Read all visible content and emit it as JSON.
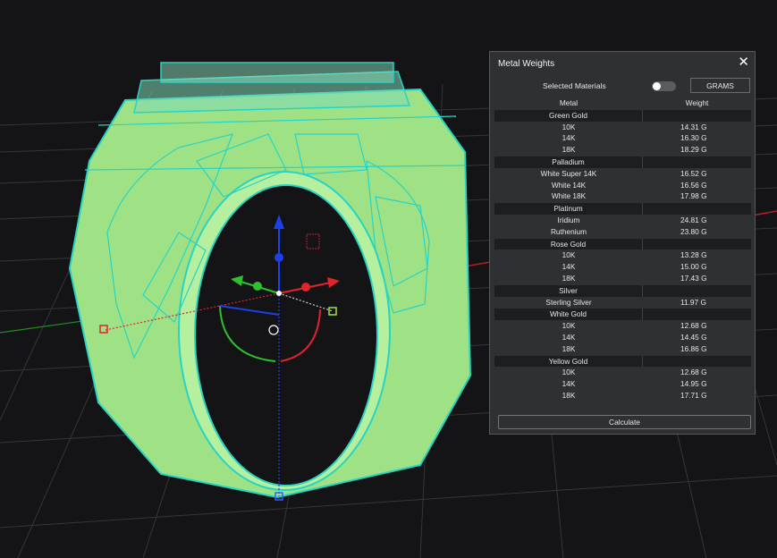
{
  "panel": {
    "title": "Metal Weights",
    "close_icon": "close-icon",
    "selected_materials_label": "Selected Materials",
    "selected_materials_on": false,
    "units_label": "GRAMS",
    "columns": {
      "metal": "Metal",
      "weight": "Weight"
    },
    "groups": [
      {
        "name": "Green Gold",
        "rows": [
          {
            "metal": "10K",
            "weight": "14.31 G"
          },
          {
            "metal": "14K",
            "weight": "16.30 G"
          },
          {
            "metal": "18K",
            "weight": "18.29 G"
          }
        ]
      },
      {
        "name": "Palladium",
        "rows": [
          {
            "metal": "White Super 14K",
            "weight": "16.52 G"
          },
          {
            "metal": "White 14K",
            "weight": "16.56 G"
          },
          {
            "metal": "White 18K",
            "weight": "17.98 G"
          }
        ]
      },
      {
        "name": "Platinum",
        "rows": [
          {
            "metal": "Iridium",
            "weight": "24.81 G"
          },
          {
            "metal": "Ruthenium",
            "weight": "23.80 G"
          }
        ]
      },
      {
        "name": "Rose Gold",
        "rows": [
          {
            "metal": "10K",
            "weight": "13.28 G"
          },
          {
            "metal": "14K",
            "weight": "15.00 G"
          },
          {
            "metal": "18K",
            "weight": "17.43 G"
          }
        ]
      },
      {
        "name": "Silver",
        "rows": [
          {
            "metal": "Sterling Silver",
            "weight": "11.97 G"
          }
        ]
      },
      {
        "name": "White Gold",
        "rows": [
          {
            "metal": "10K",
            "weight": "12.68 G"
          },
          {
            "metal": "14K",
            "weight": "14.45 G"
          },
          {
            "metal": "18K",
            "weight": "16.86 G"
          }
        ]
      },
      {
        "name": "Yellow Gold",
        "rows": [
          {
            "metal": "10K",
            "weight": "12.68 G"
          },
          {
            "metal": "14K",
            "weight": "14.95 G"
          },
          {
            "metal": "18K",
            "weight": "17.71 G"
          }
        ]
      }
    ],
    "calculate_label": "Calculate"
  },
  "viewport": {
    "background": "#141416",
    "grid_color": "#3a3a3d",
    "axis_x_color": "#e0242a",
    "axis_y_color": "#2fbf2f",
    "axis_z_color": "#1f3fe8",
    "ring_fill": "#a8e890",
    "ring_wire": "#27d4c3"
  }
}
